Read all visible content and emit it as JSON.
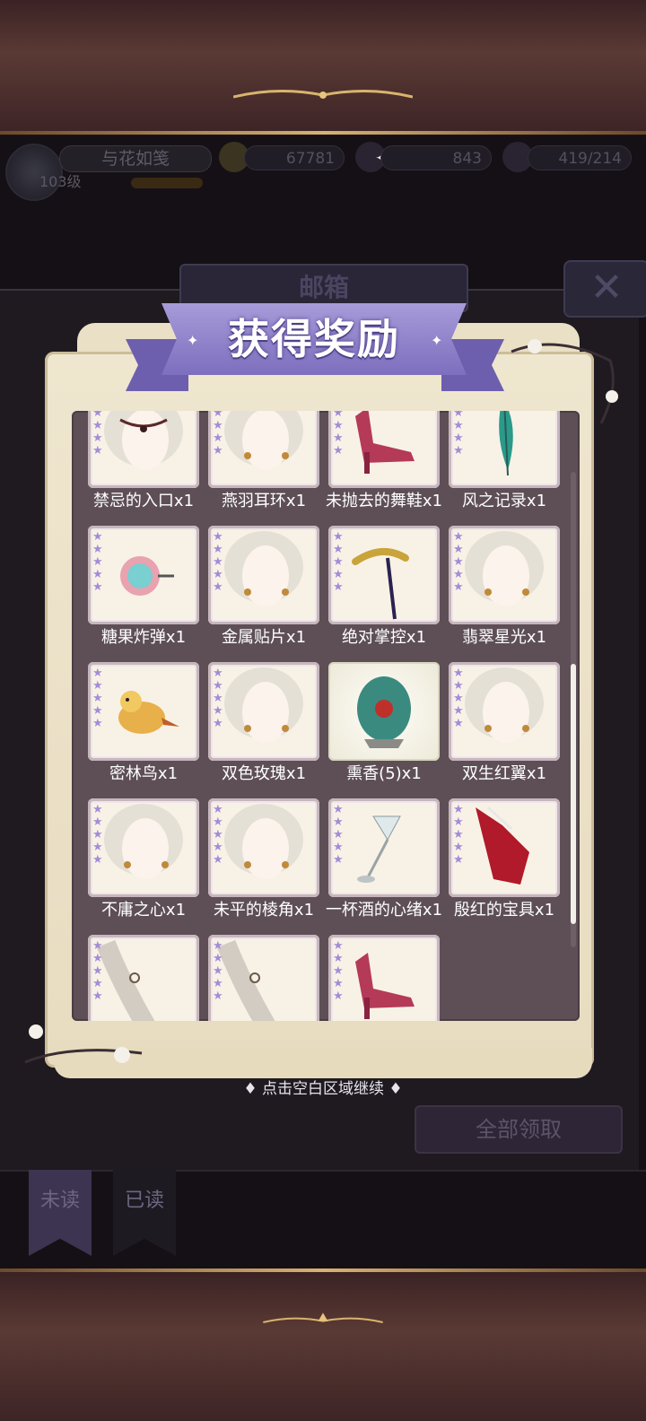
{
  "player": {
    "name": "与花如笺",
    "level": "103级"
  },
  "currencies": [
    {
      "name": "gold-coin-icon",
      "value": "67781"
    },
    {
      "name": "diamond-icon",
      "value": "843"
    },
    {
      "name": "stamina-icon",
      "value": "419/214"
    }
  ],
  "mailbox": {
    "title": "邮箱",
    "close_label": "✕",
    "claim_all_label": "全部领取",
    "tabs": [
      {
        "label": "未读"
      },
      {
        "label": "已读"
      }
    ]
  },
  "reward_popup": {
    "banner_title": "获得奖励",
    "continue_hint": "点击空白区域继续",
    "items": [
      {
        "label": "禁忌的入口x1",
        "stars": 5,
        "icon": "necklace-icon"
      },
      {
        "label": "燕羽耳环x1",
        "stars": 5,
        "icon": "earring-icon"
      },
      {
        "label": "未抛去的舞鞋x1",
        "stars": 5,
        "icon": "shoe-icon"
      },
      {
        "label": "风之记录x1",
        "stars": 5,
        "icon": "feather-icon"
      },
      {
        "label": "糖果炸弹x1",
        "stars": 5,
        "icon": "candy-icon"
      },
      {
        "label": "金属贴片x1",
        "stars": 5,
        "icon": "earring-icon"
      },
      {
        "label": "绝对掌控x1",
        "stars": 5,
        "icon": "cane-icon"
      },
      {
        "label": "翡翠星光x1",
        "stars": 5,
        "icon": "earring-icon"
      },
      {
        "label": "密林鸟x1",
        "stars": 5,
        "icon": "bird-icon"
      },
      {
        "label": "双色玫瑰x1",
        "stars": 5,
        "icon": "earring-icon"
      },
      {
        "label": "熏香(5)x1",
        "stars": 0,
        "icon": "incense-egg-icon"
      },
      {
        "label": "双生红翼x1",
        "stars": 5,
        "icon": "earring-icon"
      },
      {
        "label": "不庸之心x1",
        "stars": 5,
        "icon": "hairpin-icon"
      },
      {
        "label": "未平的棱角x1",
        "stars": 5,
        "icon": "earring-icon"
      },
      {
        "label": "一杯酒的心绪x1",
        "stars": 5,
        "icon": "wine-glass-icon"
      },
      {
        "label": "殷红的宝具x1",
        "stars": 5,
        "icon": "red-glove-icon"
      },
      {
        "label": "",
        "stars": 5,
        "icon": "bracelet-icon"
      },
      {
        "label": "",
        "stars": 5,
        "icon": "bracelet-icon"
      },
      {
        "label": "",
        "stars": 5,
        "icon": "shoe-icon"
      }
    ]
  },
  "colors": {
    "banner": "#8f80cc",
    "parchment": "#ece2c8",
    "list_bg": "#5e4f57",
    "star": "#a48bd8"
  }
}
